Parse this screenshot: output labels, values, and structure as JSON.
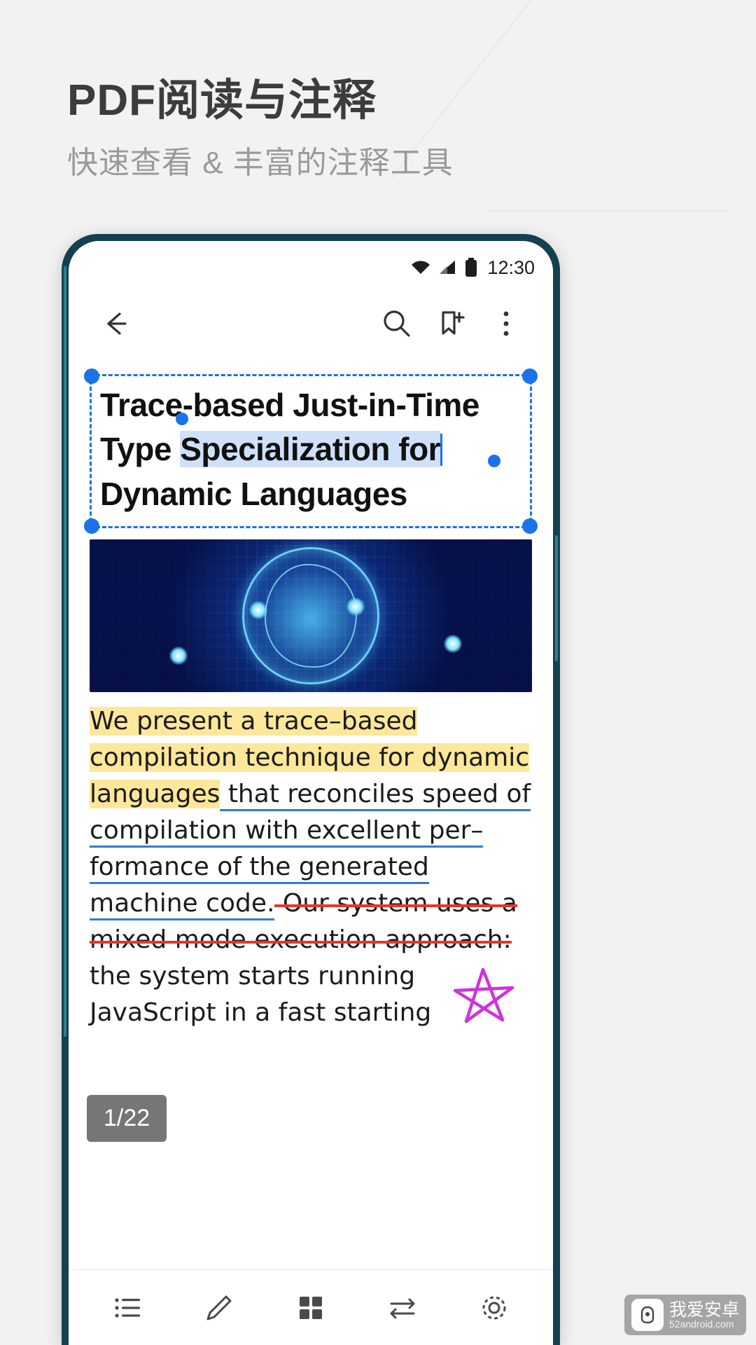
{
  "promo": {
    "headline": "PDF阅读与注释",
    "subhead": "快速查看 & 丰富的注释工具"
  },
  "phone": {
    "status_bar": {
      "time": "12:30",
      "icons": [
        "wifi-icon",
        "signal-icon",
        "battery-icon"
      ]
    },
    "app_bar": {
      "back": "back-arrow-icon",
      "search": "search-icon",
      "bookmark": "bookmark-add-icon",
      "more": "more-vertical-icon"
    },
    "document": {
      "title_lines": [
        "Trace-based Just-in-Time",
        "Type ",
        "Specialization for",
        "Dynamic Languages"
      ],
      "selected_text": "Specialization for",
      "body_lines": [
        "We present a trace–based",
        "compilation technique for dynamic",
        "languages",
        " that reconciles speed of",
        "compilation with excellent per–",
        "formance of the generated",
        "machine code.",
        " Our system uses a",
        "mixed  mode execution approach:",
        "the system starts running",
        "JavaScript in a fast  starting"
      ],
      "annotations": {
        "highlight_color": "#fde79a",
        "underline_color": "#2f7bd8",
        "strikethrough_color": "#e8362a",
        "selection_color": "#1a73e8",
        "ink_color": "#cc33dd"
      }
    },
    "page_indicator": "1/22",
    "bottom_bar": [
      {
        "name": "outline-icon"
      },
      {
        "name": "pen-icon"
      },
      {
        "name": "grid-thumbnails-icon"
      },
      {
        "name": "scroll-mode-icon"
      },
      {
        "name": "settings-gear-icon"
      }
    ]
  },
  "watermark": {
    "line1": "我爱安卓",
    "line2": "52android.com"
  },
  "colors": {
    "accent": "#1a73e8",
    "phone_frame": "#15414f",
    "page_bg": "#f2f2f2",
    "headline": "#3c3c3c",
    "subhead": "#9a9a9a"
  }
}
